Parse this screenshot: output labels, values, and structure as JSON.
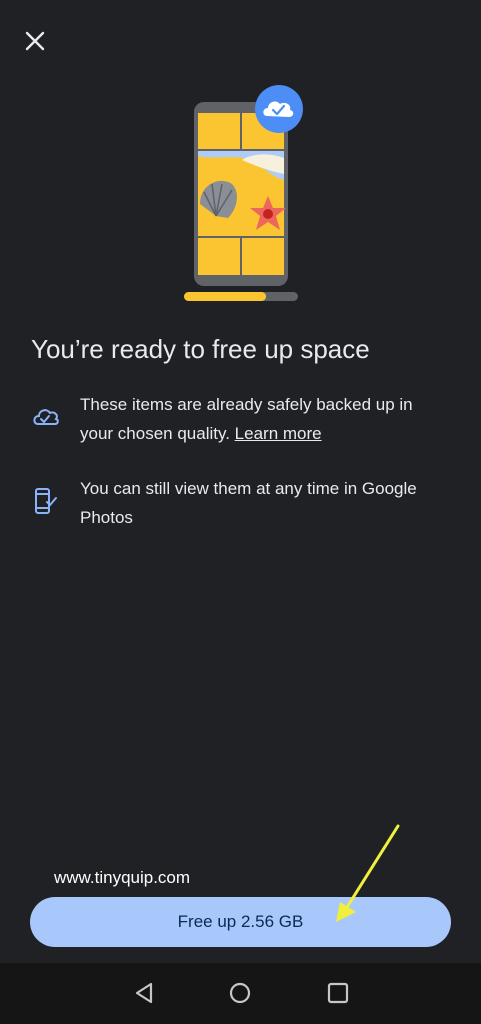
{
  "close": {
    "icon": "close-icon"
  },
  "illustration": {
    "icon": "phone-backup-illustration",
    "badge_icon": "cloud-check-icon",
    "progress": 0.72
  },
  "title": "You’re ready to free up space",
  "info": [
    {
      "icon": "cloud-done-icon",
      "text": "These items are already safely backed up in your chosen quality.",
      "link": "Learn more"
    },
    {
      "icon": "phone-check-icon",
      "text": "You can still view them at any time in Google Photos"
    }
  ],
  "watermark": "www.tinyquip.com",
  "primary_button": {
    "label": "Free up 2.56 GB"
  },
  "navbar": {
    "back_icon": "back-triangle-icon",
    "home_icon": "home-circle-icon",
    "recents_icon": "recents-square-icon"
  },
  "colors": {
    "background": "#202124",
    "accent": "#a8c7fa",
    "badge": "#4c8df6",
    "annotation_arrow": "#f0f03c"
  }
}
